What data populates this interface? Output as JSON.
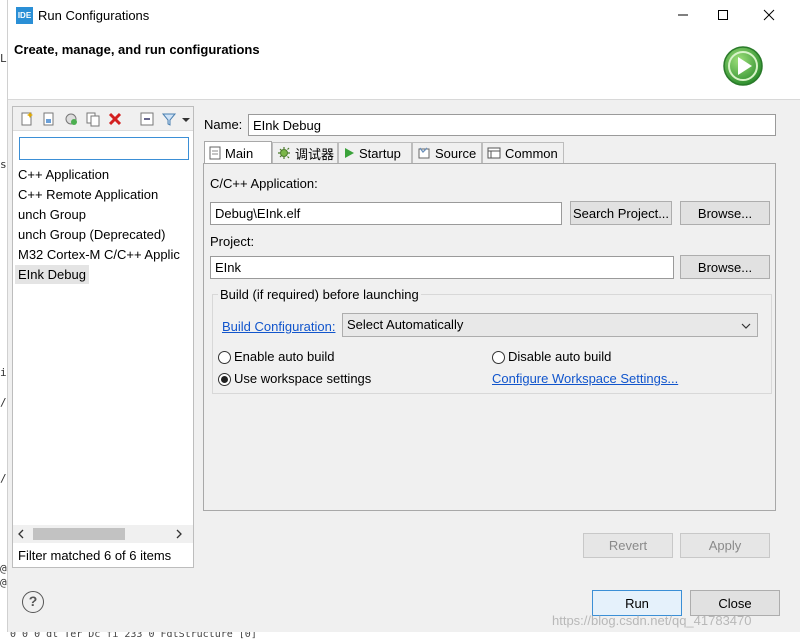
{
  "window": {
    "title": "Run Configurations",
    "logo_text": "IDE",
    "header_title": "Create, manage, and run configurations"
  },
  "left": {
    "filter_placeholder": "",
    "items": [
      {
        "label": "C++ Application"
      },
      {
        "label": "C++ Remote Application"
      },
      {
        "label": "unch Group"
      },
      {
        "label": "unch Group (Deprecated)"
      },
      {
        "label": "M32 Cortex-M C/C++ Applic"
      },
      {
        "label": "EInk Debug"
      }
    ],
    "filter_status": "Filter matched 6 of 6 items"
  },
  "config": {
    "name_label": "Name:",
    "name_value": "EInk Debug",
    "tabs": [
      {
        "label": "Main"
      },
      {
        "label": "调试器"
      },
      {
        "label": "Startup"
      },
      {
        "label": "Source"
      },
      {
        "label": "Common"
      }
    ]
  },
  "main_tab": {
    "app_label": "C/C++ Application:",
    "app_value": "Debug\\EInk.elf",
    "search_project_label": "Search Project...",
    "browse_label": "Browse...",
    "project_label": "Project:",
    "project_value": "EInk",
    "build_group_label": "Build (if required) before launching",
    "build_config_link": "Build Configuration:",
    "build_config_value": "Select Automatically",
    "enable_auto_build": "Enable auto build",
    "disable_auto_build": "Disable auto build",
    "use_workspace": "Use workspace settings",
    "configure_workspace_link": "Configure Workspace Settings..."
  },
  "buttons": {
    "revert": "Revert",
    "apply": "Apply",
    "run": "Run",
    "close": "Close",
    "help": "?"
  },
  "watermark": "https://blog.csdn.net/qq_41783470",
  "background": {
    "left_chars": [
      "L",
      "s",
      "i",
      "/",
      "/",
      "@",
      "@"
    ],
    "bottom_text": "0  0  0  dt  Ter  Dc  fi  233  0  FdtStructure [0]"
  },
  "colors": {
    "accent": "#3b8fd6",
    "link": "#1155cc",
    "run_green": "#3aa23a"
  }
}
